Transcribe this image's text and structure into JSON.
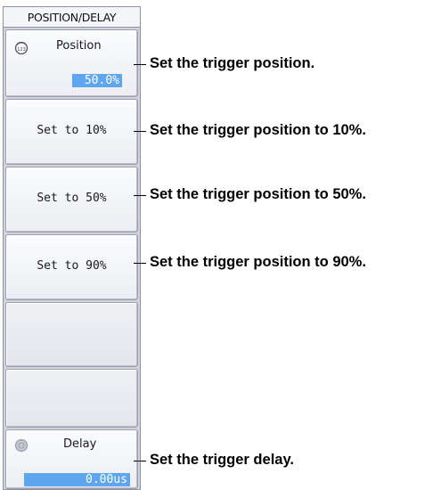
{
  "menu": {
    "title": "POSITION/DELAY",
    "position": {
      "label": "Position",
      "value": "50.0%",
      "icon": "jog-dial-icon"
    },
    "presets": [
      {
        "label": "Set to 10%"
      },
      {
        "label": "Set to 50%"
      },
      {
        "label": "Set to 90%"
      }
    ],
    "delay": {
      "label": "Delay",
      "value": "0.00us",
      "icon": "jog-dial-icon"
    }
  },
  "callouts": {
    "position": "Set the trigger position.",
    "set10": "Set the trigger position to 10%.",
    "set50": "Set the trigger position to 50%.",
    "set90": "Set the trigger position to 90%.",
    "delay": "Set the trigger delay."
  },
  "colors": {
    "highlight": "#5ea7f0",
    "panel_bg": "#cfd3dc",
    "key_face": "#f4f5f8"
  }
}
